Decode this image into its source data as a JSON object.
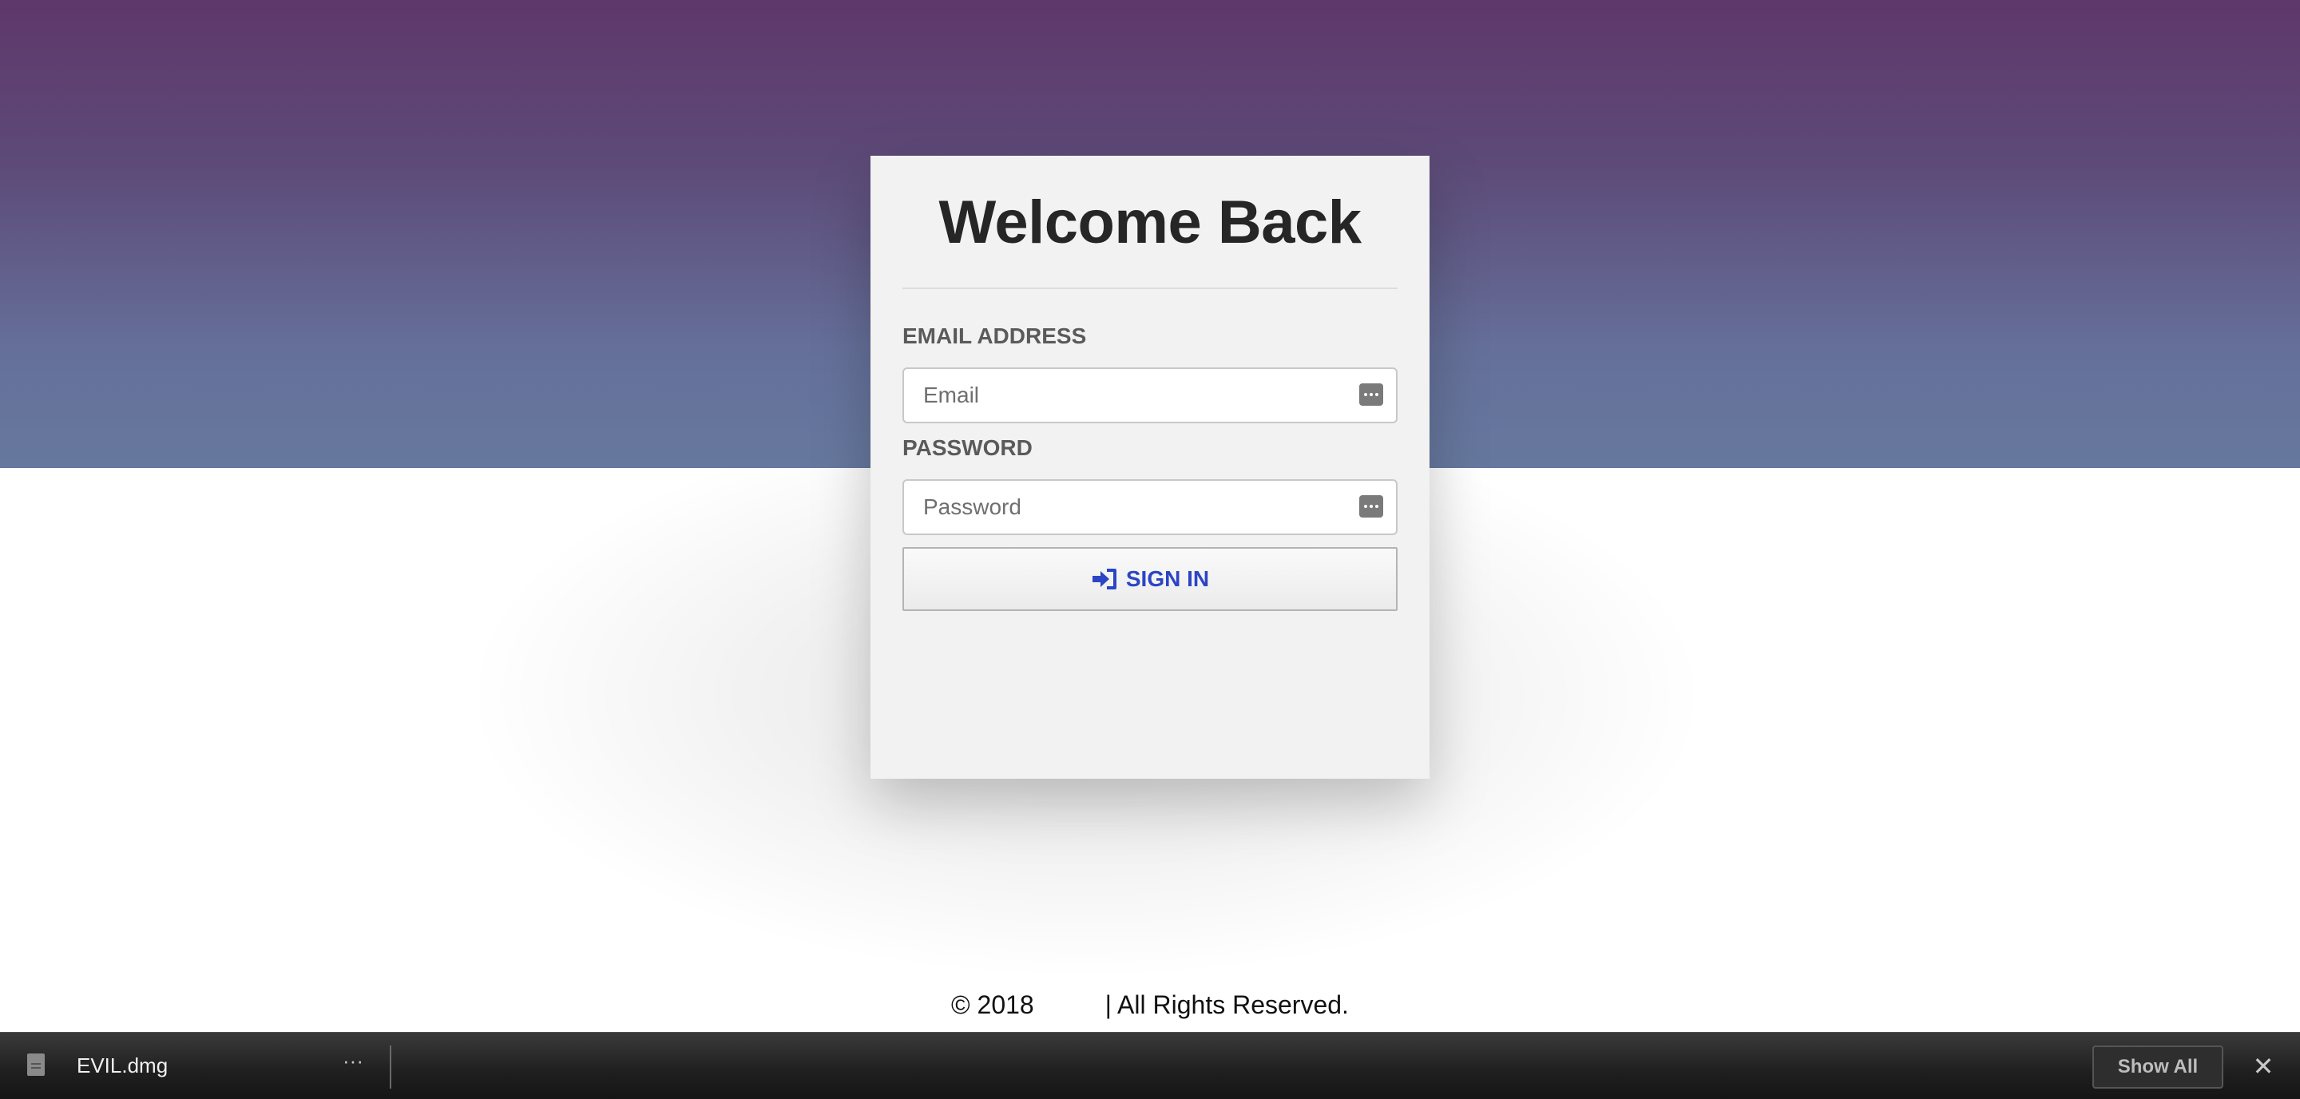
{
  "card": {
    "title": "Welcome Back",
    "email_label": "EMAIL ADDRESS",
    "email_placeholder": "Email",
    "email_value": "",
    "password_label": "PASSWORD",
    "password_placeholder": "Password",
    "password_value": "",
    "signin_label": "SIGN IN",
    "signin_icon": "sign-in-icon",
    "field_icon": "password-manager-key-icon"
  },
  "footer": {
    "copyright": "© 2018",
    "gap": "          ",
    "rights": "| All Rights Reserved."
  },
  "download_bar": {
    "file_name": "EVIL.dmg",
    "file_icon": "document-icon",
    "more_label": "···",
    "show_all_label": "Show All",
    "close_label": "✕"
  },
  "colors": {
    "hero_top": "#5e376b",
    "hero_bottom": "#66789e",
    "card_bg": "#f2f2f2",
    "signin_text": "#2b45c4",
    "bar_bg": "#1f1f1f"
  }
}
